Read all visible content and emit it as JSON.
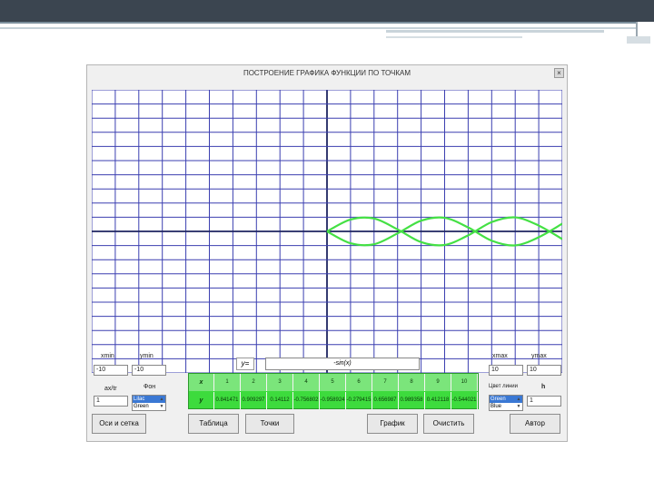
{
  "window": {
    "title": "ПОСТРОЕНИЕ ГРАФИКА ФУНКЦИИ ПО ТОЧКАМ",
    "close_glyph": "×"
  },
  "colors": {
    "grid_minor": "#3b3fb0",
    "grid_axis": "#1e2560",
    "curve": "#44e044",
    "table_bg": "#3ddb3d"
  },
  "controls": {
    "xmin": {
      "label": "xmin",
      "value": "-10"
    },
    "ymin": {
      "label": "ymin",
      "value": "-10"
    },
    "xmax": {
      "label": "xmax",
      "value": "10"
    },
    "ymax": {
      "label": "ymax",
      "value": "10"
    },
    "axstr": {
      "label": "ax/tr",
      "value": "1"
    },
    "background": {
      "label": "Фон",
      "options": [
        "Lilac",
        "Green"
      ],
      "selected": "Lilac"
    },
    "line_color": {
      "label": "Цвет линии",
      "options": [
        "Green",
        "Blue"
      ],
      "selected": "Green"
    },
    "h": {
      "label": "h",
      "value": "1"
    }
  },
  "formula": {
    "label": "y=",
    "value": "-sin(x)"
  },
  "table": {
    "x_label": "x",
    "y_label": "y",
    "x_values": [
      "1",
      "2",
      "3",
      "4",
      "5",
      "6",
      "7",
      "8",
      "9",
      "10"
    ],
    "y_values": [
      "0.841471",
      "0.909297",
      "0.14112",
      "-0.756802",
      "-0.958924",
      "-0.279415",
      "0.656987",
      "0.989358",
      "0.412118",
      "-0.544021"
    ]
  },
  "buttons": {
    "axes_grid": "Оси и сетка",
    "table": "Таблица",
    "points": "Точки",
    "graph": "График",
    "clear": "Очистить",
    "author": "Автор"
  },
  "chart_data": {
    "type": "line",
    "xlim": [
      -10,
      10
    ],
    "ylim": [
      -10,
      10
    ],
    "grid": true,
    "series": [
      {
        "x": [
          0,
          1,
          2,
          3,
          4,
          5,
          6,
          7,
          8,
          9,
          10
        ],
        "values": [
          0,
          0.841,
          0.909,
          0.141,
          -0.757,
          -0.959,
          -0.279,
          0.657,
          0.989,
          0.412,
          -0.544
        ]
      },
      {
        "x": [
          0,
          1,
          2,
          3,
          4,
          5,
          6,
          7,
          8,
          9,
          10
        ],
        "values": [
          0,
          -0.841,
          -0.909,
          -0.141,
          0.757,
          0.959,
          0.279,
          -0.657,
          -0.989,
          -0.412,
          0.544
        ]
      }
    ]
  }
}
